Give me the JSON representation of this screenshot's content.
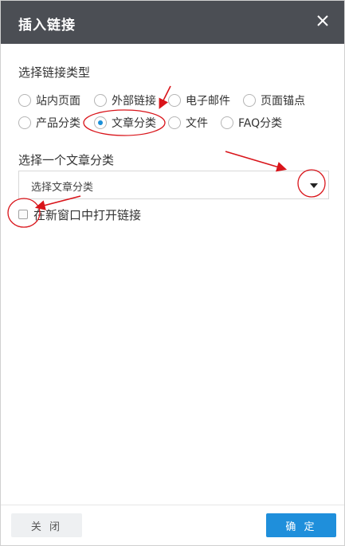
{
  "dialog": {
    "title": "插入链接",
    "close_icon": "close-icon"
  },
  "link_type": {
    "label": "选择链接类型",
    "options": [
      {
        "label": "站内页面",
        "checked": false
      },
      {
        "label": "外部链接",
        "checked": false
      },
      {
        "label": "电子邮件",
        "checked": false
      },
      {
        "label": "页面锚点",
        "checked": false
      },
      {
        "label": "产品分类",
        "checked": false
      },
      {
        "label": "文章分类",
        "checked": true
      },
      {
        "label": "文件",
        "checked": false
      },
      {
        "label": "FAQ分类",
        "checked": false
      }
    ]
  },
  "category": {
    "label": "选择一个文章分类",
    "select_value": "选择文章分类",
    "caret_icon": "caret-down-icon"
  },
  "new_window": {
    "label": "在新窗口中打开链接",
    "checked": false
  },
  "footer": {
    "close_label": "关 闭",
    "ok_label": "确 定"
  },
  "colors": {
    "titlebar": "#4b4e54",
    "primary": "#1f8fdb",
    "radio_selected": "#1a8fd8",
    "annotation": "#d9141a"
  }
}
